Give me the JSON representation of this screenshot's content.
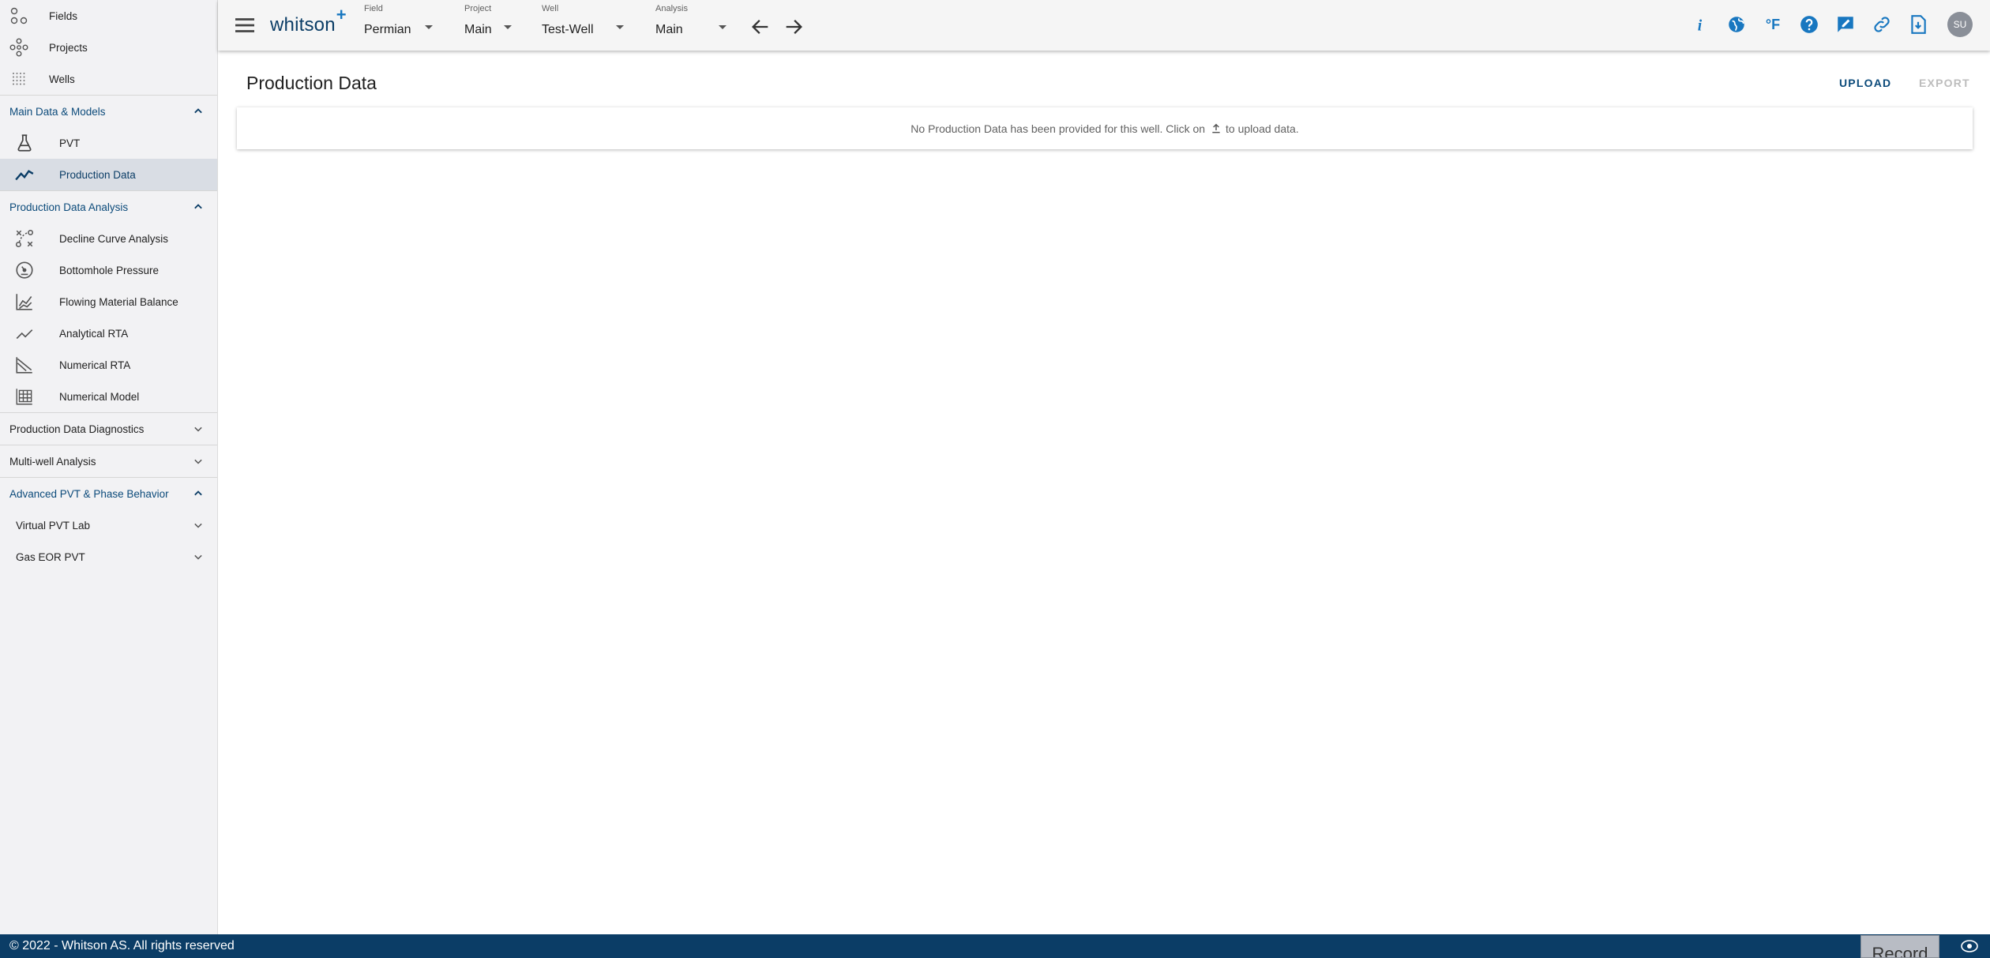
{
  "sidebar": {
    "top_items": [
      {
        "label": "Fields",
        "icon": "fields-icon"
      },
      {
        "label": "Projects",
        "icon": "projects-icon"
      },
      {
        "label": "Wells",
        "icon": "wells-icon"
      }
    ],
    "sections": {
      "main_data": {
        "label": "Main Data & Models",
        "expanded": true,
        "items": [
          {
            "label": "PVT",
            "icon": "flask-icon"
          },
          {
            "label": "Production Data",
            "icon": "trend-line-icon",
            "active": true
          }
        ]
      },
      "pda": {
        "label": "Production Data Analysis",
        "expanded": true,
        "items": [
          {
            "label": "Decline Curve Analysis",
            "icon": "decline-curve-icon"
          },
          {
            "label": "Bottomhole Pressure",
            "icon": "gauge-icon"
          },
          {
            "label": "Flowing Material Balance",
            "icon": "area-chart-icon"
          },
          {
            "label": "Analytical RTA",
            "icon": "line-chart-icon"
          },
          {
            "label": "Numerical RTA",
            "icon": "numerical-rta-icon"
          },
          {
            "label": "Numerical Model",
            "icon": "grid-model-icon"
          }
        ]
      },
      "pdd": {
        "label": "Production Data Diagnostics",
        "expanded": false
      },
      "mwa": {
        "label": "Multi-well Analysis",
        "expanded": false
      },
      "adv_pvt": {
        "label": "Advanced PVT & Phase Behavior",
        "expanded": true,
        "subsections": [
          {
            "label": "Virtual PVT Lab",
            "expanded": false
          },
          {
            "label": "Gas EOR PVT",
            "expanded": false
          }
        ]
      }
    }
  },
  "topbar": {
    "logo": "whitson",
    "logo_plus": "+",
    "selectors": {
      "field": {
        "label": "Field",
        "value": "Permian"
      },
      "project": {
        "label": "Project",
        "value": "Main"
      },
      "well": {
        "label": "Well",
        "value": "Test-Well"
      },
      "analysis": {
        "label": "Analysis",
        "value": "Main"
      }
    },
    "units_label": "°F",
    "avatar_initials": "SU"
  },
  "main": {
    "title": "Production Data",
    "upload_label": "UPLOAD",
    "export_label": "EXPORT",
    "empty_message_before": "No Production Data has been provided for this well. Click on",
    "empty_message_after": "to upload data."
  },
  "footer": {
    "copyright": "© 2022 - Whitson AS. All rights reserved",
    "record_label": "Record"
  },
  "colors": {
    "brand_navy": "#0b3d66",
    "accent_blue": "#1877c0",
    "sidebar_bg": "#f2f2f4",
    "active_bg": "#d9dde4",
    "disabled_text": "#bdbdbd"
  }
}
